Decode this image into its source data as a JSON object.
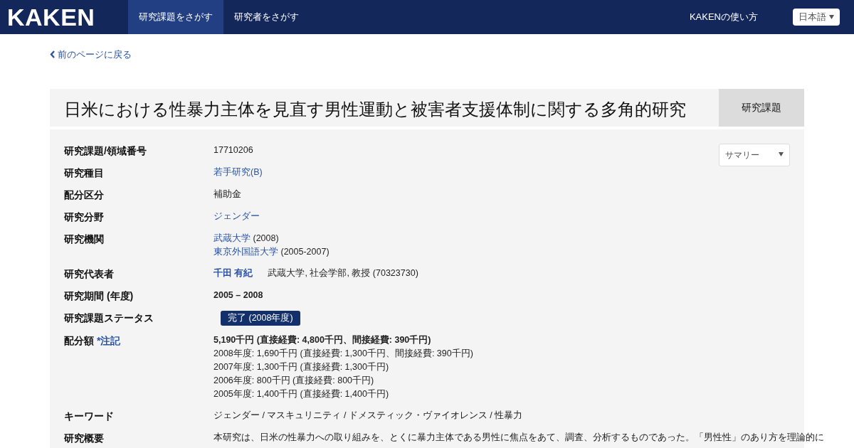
{
  "navbar": {
    "logo": "KAKEN",
    "nav_items": [
      {
        "label": "研究課題をさがす",
        "selected": true
      },
      {
        "label": "研究者をさがす",
        "selected": false
      }
    ],
    "help_link": "KAKENの使い方",
    "language": "日本語"
  },
  "back_link": "前のページに戻る",
  "project": {
    "title": "日米における性暴力主体を見直す男性運動と被害者支援体制に関する多角的研究",
    "type_label": "研究課題",
    "view_select": "サマリー"
  },
  "fields": [
    {
      "label": "研究課題/領域番号",
      "lines": [
        [
          {
            "kind": "text",
            "text": "17710206"
          }
        ]
      ]
    },
    {
      "label": "研究種目",
      "lines": [
        [
          {
            "kind": "link",
            "text": "若手研究(B)"
          }
        ]
      ]
    },
    {
      "label": "配分区分",
      "lines": [
        [
          {
            "kind": "text",
            "text": "補助金"
          }
        ]
      ]
    },
    {
      "label": "研究分野",
      "lines": [
        [
          {
            "kind": "link",
            "text": "ジェンダー"
          }
        ]
      ]
    },
    {
      "label": "研究機関",
      "lines": [
        [
          {
            "kind": "link",
            "text": "武蔵大学"
          },
          {
            "kind": "text",
            "text": "(2008)"
          }
        ],
        [
          {
            "kind": "link",
            "text": "東京外国語大学"
          },
          {
            "kind": "text",
            "text": "(2005-2007)"
          }
        ]
      ]
    },
    {
      "label": "研究代表者",
      "lines": [
        [
          {
            "kind": "person",
            "text": "千田 有紀"
          },
          {
            "kind": "affiliation",
            "text": "武蔵大学, 社会学部, 教授 (70323730)"
          }
        ]
      ]
    },
    {
      "label": "研究期間 (年度)",
      "lines": [
        [
          {
            "kind": "bold",
            "text": "2005 – 2008"
          }
        ]
      ]
    },
    {
      "label": "研究課題ステータス",
      "lines": [
        [
          {
            "kind": "badge",
            "text": "完了 (2008年度)"
          }
        ]
      ]
    },
    {
      "label": "配分額",
      "note": "*注記",
      "lines": [
        [
          {
            "kind": "bold",
            "text": "5,190千円 (直接経費: 4,800千円、間接経費: 390千円)"
          }
        ],
        [
          {
            "kind": "text",
            "text": "2008年度: 1,690千円 (直接経費: 1,300千円、間接経費: 390千円)"
          }
        ],
        [
          {
            "kind": "text",
            "text": "2007年度: 1,300千円 (直接経費: 1,300千円)"
          }
        ],
        [
          {
            "kind": "text",
            "text": "2006年度: 800千円 (直接経費: 800千円)"
          }
        ],
        [
          {
            "kind": "text",
            "text": "2005年度: 1,400千円 (直接経費: 1,400千円)"
          }
        ]
      ]
    },
    {
      "label": "キーワード",
      "lines": [
        [
          {
            "kind": "text",
            "text": "ジェンダー / マスキュリニティ / ドメスティック・ヴァイオレンス / 性暴力"
          }
        ]
      ]
    },
    {
      "label": "研究概要",
      "lines": [
        [
          {
            "kind": "text",
            "text": "本研究は、日米の性暴力への取り組みを、とくに暴力主体である男性に焦点をあて、調査、分析するものであった。「男性性」のあり方を理論的に"
          }
        ]
      ]
    }
  ]
}
